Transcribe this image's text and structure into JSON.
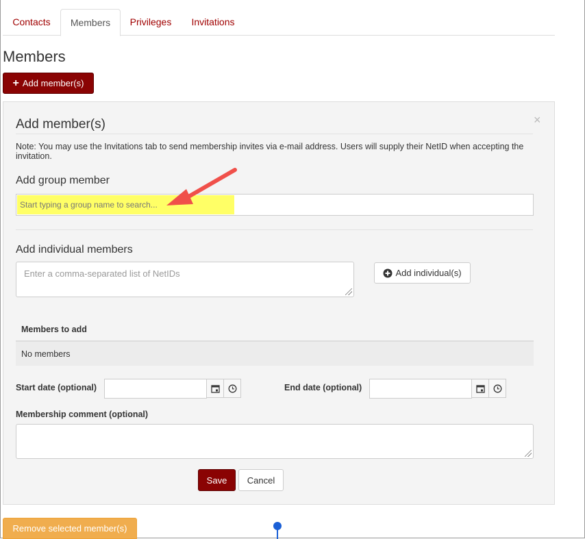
{
  "tabs": [
    {
      "label": "Contacts"
    },
    {
      "label": "Members"
    },
    {
      "label": "Privileges"
    },
    {
      "label": "Invitations"
    }
  ],
  "page_title": "Members",
  "add_members_button": "Add member(s)",
  "panel": {
    "title": "Add member(s)",
    "close": "×",
    "note": "Note: You may use the Invitations tab to send membership invites via e-mail address. Users will supply their NetID when accepting the invitation.",
    "group_heading": "Add group member",
    "group_placeholder": "Start typing a group name to search...",
    "individual_heading": "Add individual members",
    "individual_placeholder": "Enter a comma-separated list of NetIDs",
    "add_individual_button": "Add individual(s)",
    "members_table_header": "Members to add",
    "members_table_empty": "No members",
    "start_date_label": "Start date (optional)",
    "end_date_label": "End date (optional)",
    "comment_label": "Membership comment (optional)",
    "save_button": "Save",
    "cancel_button": "Cancel"
  },
  "remove_button": "Remove selected member(s)",
  "colors": {
    "accent": "#8a0303",
    "warning": "#f0ad4e",
    "highlight": "#ffff66",
    "annotation_arrow": "#f0504a"
  }
}
